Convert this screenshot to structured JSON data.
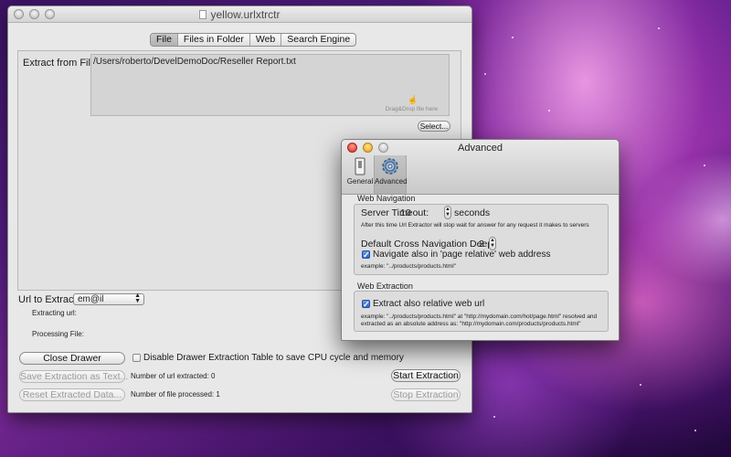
{
  "main_window": {
    "title": "yellow.urlxtrctr",
    "tabs": [
      "File",
      "Files in Folder",
      "Web",
      "Search Engine"
    ],
    "active_tab": "File",
    "extract_from_label": "Extract from File:",
    "file_path": "/Users/roberto/DevelDemoDoc/Reseller Report.txt",
    "drop_hint": "Drag&Drop file here",
    "select_button": "Select...",
    "url_to_extract_label": "Url to Extract:",
    "url_to_extract_value": "em@il",
    "extracting_url_label": "Extracting url:",
    "processing_file_label": "Processing File:",
    "close_drawer_button": "Close Drawer",
    "disable_drawer_label": "Disable Drawer Extraction Table to save CPU cycle and memory",
    "save_extraction_button": "Save Extraction as Text...",
    "reset_button": "Reset Extracted Data...",
    "num_url_extracted": "Number of url extracted: 0",
    "num_file_processed": "Number of file processed: 1",
    "start_button": "Start Extraction",
    "stop_button": "Stop Extraction"
  },
  "advanced_window": {
    "title": "Advanced",
    "toolbar": [
      {
        "label": "General",
        "icon": "switch-icon"
      },
      {
        "label": "Advanced",
        "icon": "gear-icon"
      }
    ],
    "web_navigation": {
      "title": "Web Navigation",
      "server_timeout_label": "Server Timeout:",
      "server_timeout_value": "10",
      "seconds_label": "seconds",
      "timeout_note": "After this time Url Extractor will stop wait for answer for any request it makes to servers",
      "cross_nav_label": "Default Cross Navigation Deep:",
      "cross_nav_value": "2",
      "navigate_relative_label": "Navigate also in 'page relative' web address",
      "navigate_relative_checked": true,
      "example": "example: \"../products/products.html\""
    },
    "web_extraction": {
      "title": "Web Extraction",
      "extract_relative_label": "Extract also relative web url",
      "extract_relative_checked": true,
      "example_line1": "example: \"../products/products.html\" at \"http://mydomain.com/hot/page.html\" resolved and",
      "example_line2": "extracted as an absolute address as: \"http://mydomain.com/products/products.html\""
    }
  },
  "colors": {
    "checkbox_blue": "#2b67c7",
    "wallpaper_purple": "#5a1f8a"
  }
}
